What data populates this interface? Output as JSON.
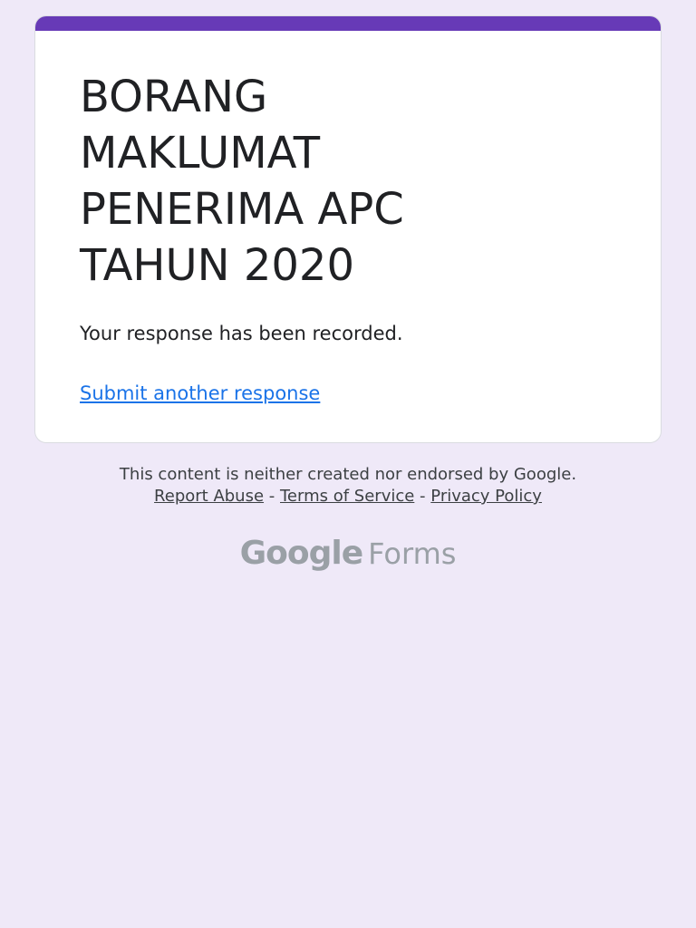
{
  "form": {
    "title": "BORANG MAKLUMAT PENERIMA APC TAHUN 2020",
    "confirmation": "Your response has been recorded.",
    "submit_another_label": "Submit another response"
  },
  "footer": {
    "disclaimer": "This content is neither created nor endorsed by Google.",
    "links": {
      "report_abuse": "Report Abuse",
      "terms": "Terms of Service",
      "privacy": "Privacy Policy",
      "separator": " - "
    }
  },
  "brand": {
    "google": "Google",
    "forms": "Forms"
  },
  "colors": {
    "accent": "#673ab7",
    "background": "#efe9f8",
    "link": "#1a73e8"
  }
}
